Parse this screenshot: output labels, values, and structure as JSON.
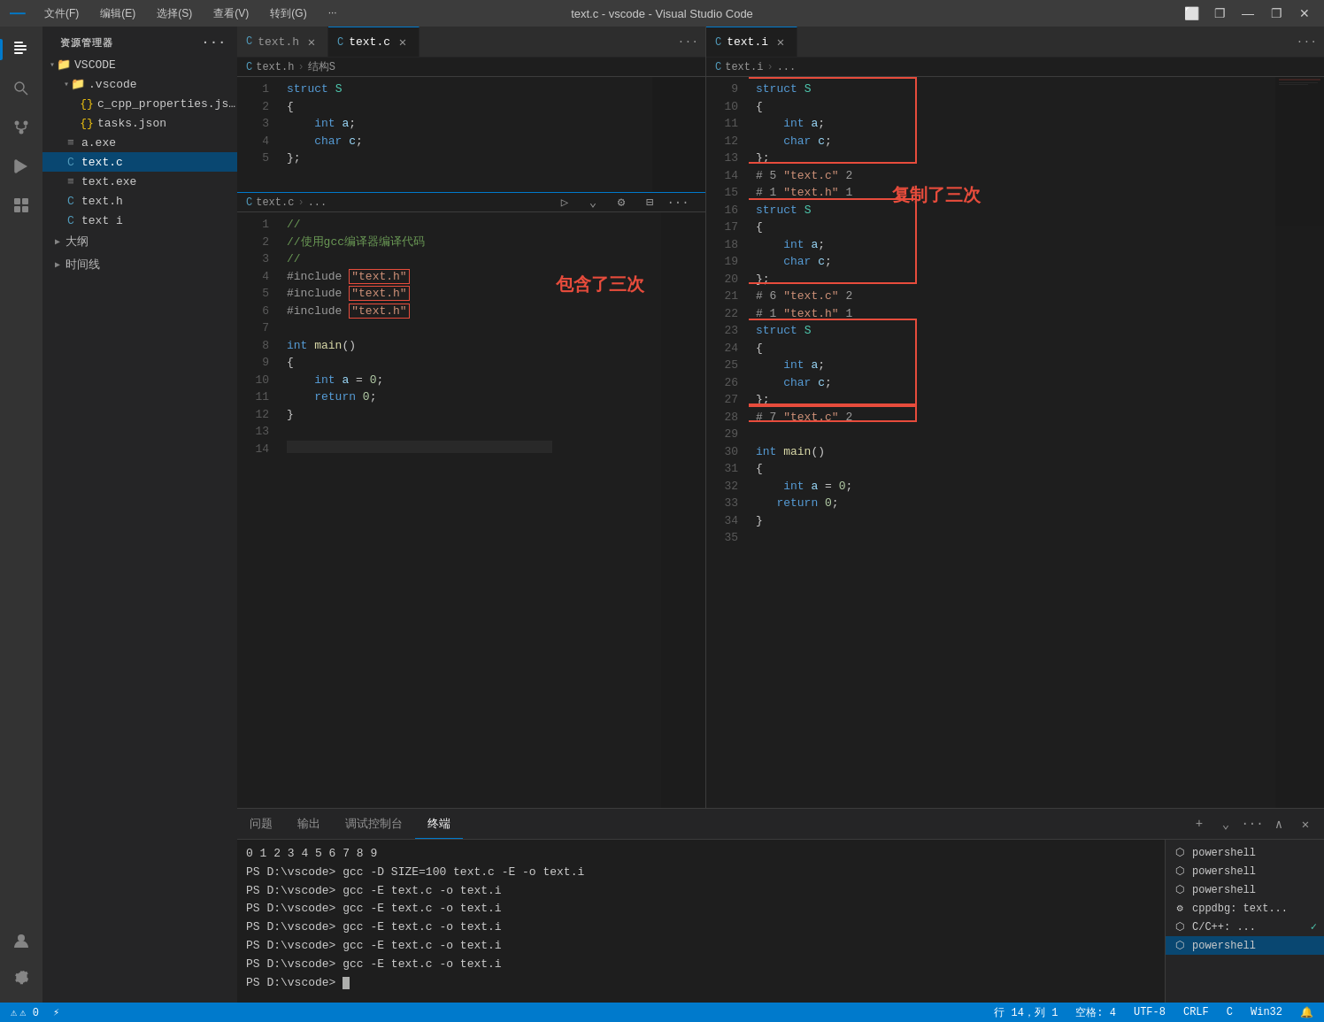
{
  "titlebar": {
    "logo": "X",
    "menus": [
      "文件(F)",
      "编辑(E)",
      "选择(S)",
      "查看(V)",
      "转到(G)",
      "···"
    ],
    "title": "text.c - vscode - Visual Studio Code",
    "controls": [
      "⬜",
      "❐",
      "—",
      "✕"
    ]
  },
  "sidebar": {
    "header": "资源管理器",
    "more_icon": "···",
    "vscode_label": "VSCODE",
    "tree": [
      {
        "label": ".vscode",
        "type": "folder",
        "indent": 1,
        "expanded": true
      },
      {
        "label": "c_cpp_properties.json",
        "type": "json",
        "indent": 2
      },
      {
        "label": "tasks.json",
        "type": "json",
        "indent": 2
      },
      {
        "label": "a.exe",
        "type": "exe",
        "indent": 1
      },
      {
        "label": "text.c",
        "type": "c",
        "indent": 1,
        "active": true
      },
      {
        "label": "text.exe",
        "type": "exe",
        "indent": 1
      },
      {
        "label": "text.h",
        "type": "c",
        "indent": 1
      },
      {
        "label": "text.i",
        "type": "c",
        "indent": 1
      }
    ],
    "outline_label": "大纲",
    "timeline_label": "时间线"
  },
  "left_editor": {
    "tabs": [
      {
        "label": "text.h",
        "icon": "C",
        "active": false,
        "closable": true
      },
      {
        "label": "text.c",
        "icon": "C",
        "active": true,
        "closable": true
      }
    ],
    "breadcrumb_texth": "text.h > 结构S",
    "breadcrumb_textc": "text.c > ...",
    "text_h_lines": [
      {
        "num": 1,
        "code": "struct S"
      },
      {
        "num": 2,
        "code": "{"
      },
      {
        "num": 3,
        "code": "    int a;"
      },
      {
        "num": 4,
        "code": "    char c;"
      },
      {
        "num": 5,
        "code": "};"
      }
    ],
    "text_c_lines": [
      {
        "num": 1,
        "code": "//"
      },
      {
        "num": 2,
        "code": "//使用gcc编译器编译代码"
      },
      {
        "num": 3,
        "code": "//"
      },
      {
        "num": 4,
        "code": "#include \"text.h\""
      },
      {
        "num": 5,
        "code": "#include \"text.h\""
      },
      {
        "num": 6,
        "code": "#include \"text.h\""
      },
      {
        "num": 7,
        "code": ""
      },
      {
        "num": 8,
        "code": "int main()"
      },
      {
        "num": 9,
        "code": "{"
      },
      {
        "num": 10,
        "code": "    int a = 0;"
      },
      {
        "num": 11,
        "code": "    return 0;"
      },
      {
        "num": 12,
        "code": "}"
      },
      {
        "num": 13,
        "code": ""
      },
      {
        "num": 14,
        "code": ""
      }
    ],
    "annot_include": "包含了三次"
  },
  "right_editor": {
    "tab_label": "text.i",
    "breadcrumb": "text.i > ...",
    "lines": [
      {
        "num": 9,
        "code": "struct S"
      },
      {
        "num": 10,
        "code": "{"
      },
      {
        "num": 11,
        "code": "    int a;"
      },
      {
        "num": 12,
        "code": "    char c;"
      },
      {
        "num": 13,
        "code": "};"
      },
      {
        "num": 14,
        "code": "# 5 \"text.c\" 2"
      },
      {
        "num": 15,
        "code": "# 1 \"text.h\" 1"
      },
      {
        "num": 16,
        "code": "struct S"
      },
      {
        "num": 17,
        "code": "{"
      },
      {
        "num": 18,
        "code": "    int a;"
      },
      {
        "num": 19,
        "code": "    char c;"
      },
      {
        "num": 20,
        "code": "};"
      },
      {
        "num": 21,
        "code": "# 6 \"text.c\" 2"
      },
      {
        "num": 22,
        "code": "# 1 \"text.h\" 1"
      },
      {
        "num": 23,
        "code": "struct S"
      },
      {
        "num": 24,
        "code": "{"
      },
      {
        "num": 25,
        "code": "    int a;"
      },
      {
        "num": 26,
        "code": "    char c;"
      },
      {
        "num": 27,
        "code": "};"
      },
      {
        "num": 28,
        "code": "# 7 \"text.c\" 2"
      },
      {
        "num": 29,
        "code": ""
      },
      {
        "num": 30,
        "code": "int main()"
      },
      {
        "num": 31,
        "code": "{"
      },
      {
        "num": 32,
        "code": "    int a = 0;"
      },
      {
        "num": 33,
        "code": "    return 0;"
      },
      {
        "num": 34,
        "code": "}"
      },
      {
        "num": 35,
        "code": ""
      }
    ],
    "annot_copy": "复制了三次"
  },
  "panel": {
    "tabs": [
      "问题",
      "输出",
      "调试控制台",
      "终端"
    ],
    "active_tab": "终端",
    "terminal_lines": [
      "0 1 2 3 4 5 6 7 8 9",
      "PS D:\\vscode> gcc -D SIZE=100 text.c -E -o text.i",
      "PS D:\\vscode> gcc -E text.c -o text.i",
      "PS D:\\vscode> gcc -E text.c -o text.i",
      "PS D:\\vscode> gcc -E text.c -o text.i",
      "PS D:\\vscode> gcc -E text.c -o text.i",
      "PS D:\\vscode> gcc -E text.c -o text.i"
    ],
    "terminal_prompt": "PS D:\\vscode> ",
    "right_items": [
      {
        "label": "powershell",
        "icon": "⬡",
        "active": false
      },
      {
        "label": "powershell",
        "icon": "⬡",
        "active": false
      },
      {
        "label": "powershell",
        "icon": "⬡",
        "active": false
      },
      {
        "label": "cppdbg: text...",
        "icon": "⚙",
        "active": false
      },
      {
        "label": "C/C++: ...",
        "icon": "⬡",
        "active": false
      },
      {
        "label": "powershell",
        "icon": "⬡",
        "active": true
      }
    ]
  },
  "statusbar": {
    "left_items": [
      "⚠ 0",
      "⚡"
    ],
    "line_col": "行 14，列 1",
    "spaces": "空格: 4",
    "encoding": "UTF-8",
    "eol": "CRLF",
    "language": "C",
    "os": "Win32",
    "notifications": "🔔"
  }
}
